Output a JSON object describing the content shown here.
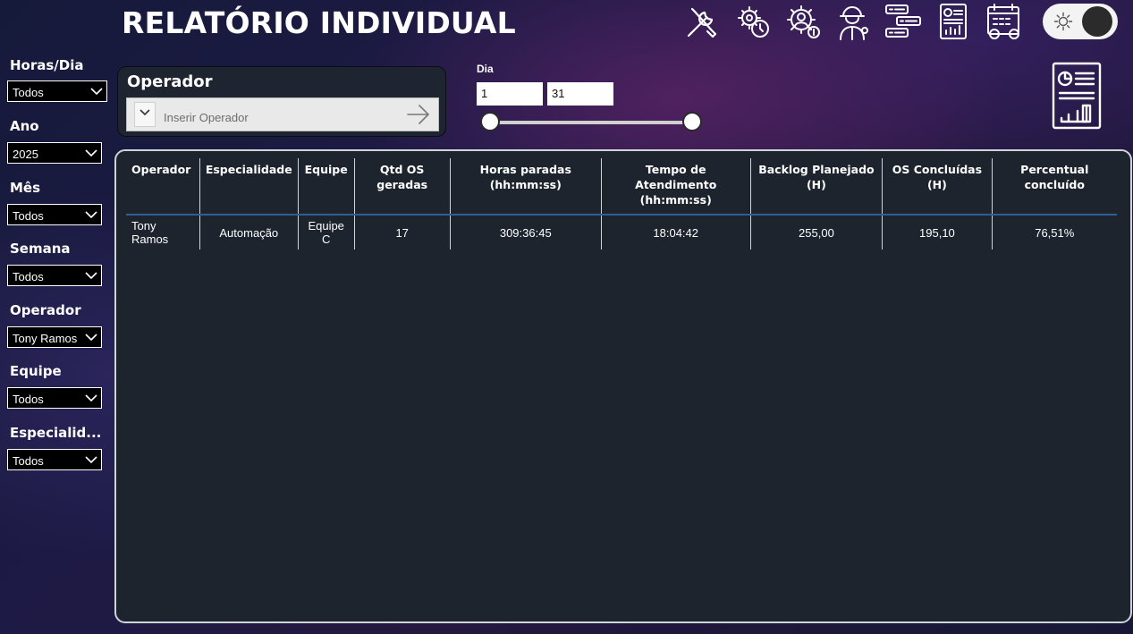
{
  "header": {
    "title": "RELATÓRIO INDIVIDUAL"
  },
  "nav_icons": [
    "tools-icon",
    "gear-clock-icon",
    "gear-dollar-icon",
    "worker-icon",
    "list-flow-icon",
    "report-chart-icon",
    "calendar-gear-icon"
  ],
  "theme_toggle": {
    "icon": "sun-icon",
    "state": "dark"
  },
  "filters": {
    "horas_dia": {
      "label": "Horas/Dia",
      "value": "Todos"
    },
    "ano": {
      "label": "Ano",
      "value": "2025"
    },
    "mes": {
      "label": "Mês",
      "value": "Todos"
    },
    "semana": {
      "label": "Semana",
      "value": "Todos"
    },
    "operador": {
      "label": "Operador",
      "value": "Tony Ramos"
    },
    "equipe": {
      "label": "Equipe",
      "value": "Todos"
    },
    "especialidade": {
      "label": "Especialid...",
      "value": "Todos"
    }
  },
  "operator_search": {
    "title": "Operador",
    "placeholder": "Inserir Operador"
  },
  "dia_slider": {
    "label": "Dia",
    "min_value": "1",
    "max_value": "31"
  },
  "table": {
    "columns": [
      "Operador",
      "Especialidade",
      "Equipe",
      "Qtd OS geradas",
      "Horas paradas (hh:mm:ss)",
      "Tempo de Atendimento (hh:mm:ss)",
      "Backlog Planejado (H)",
      "OS Concluídas (H)",
      "Percentual concluído"
    ],
    "rows": [
      [
        "Tony Ramos",
        "Automação",
        "Equipe C",
        "17",
        "309:36:45",
        "18:04:42",
        "255,00",
        "195,10",
        "76,51%"
      ]
    ]
  }
}
